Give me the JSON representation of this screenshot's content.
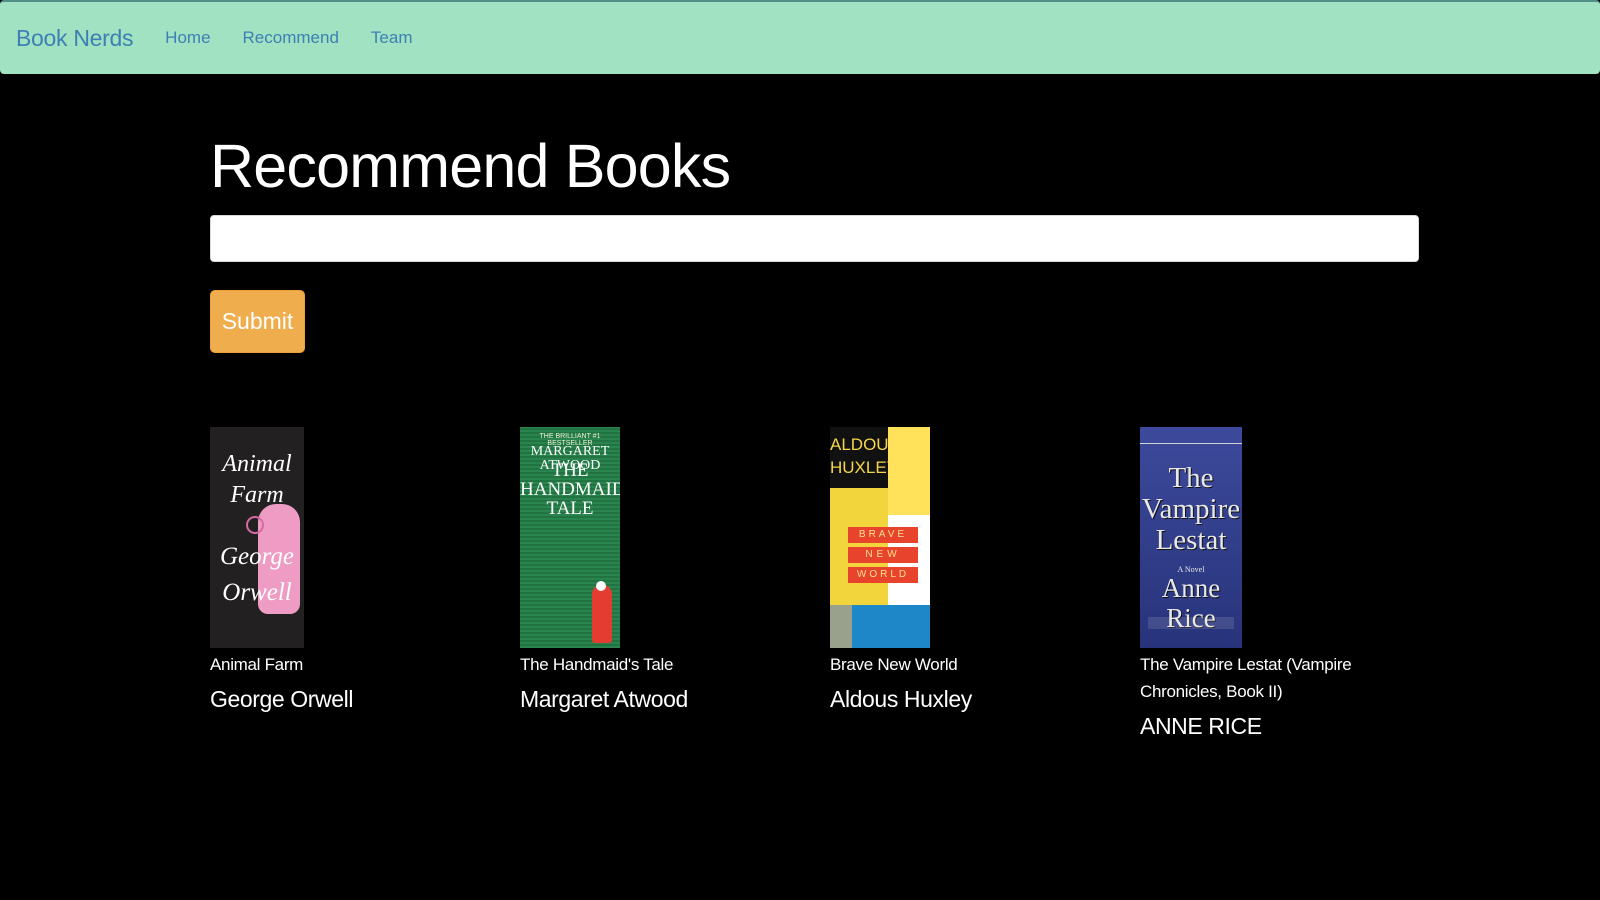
{
  "navbar": {
    "brand": "Book Nerds",
    "links": [
      "Home",
      "Recommend",
      "Team"
    ],
    "bg_color": "#a0e2c2",
    "link_color": "#3f7fb3"
  },
  "main": {
    "title": "Recommend Books",
    "input_value": "",
    "submit_label": "Submit",
    "submit_color": "#f0ad4e"
  },
  "books": [
    {
      "title": "Animal Farm",
      "author": "George Orwell"
    },
    {
      "title": "The Handmaid's Tale",
      "author": "Margaret Atwood"
    },
    {
      "title": "Brave New World",
      "author": "Aldous Huxley"
    },
    {
      "title": "The Vampire Lestat (Vampire Chronicles, Book II)",
      "author": "ANNE RICE"
    }
  ]
}
